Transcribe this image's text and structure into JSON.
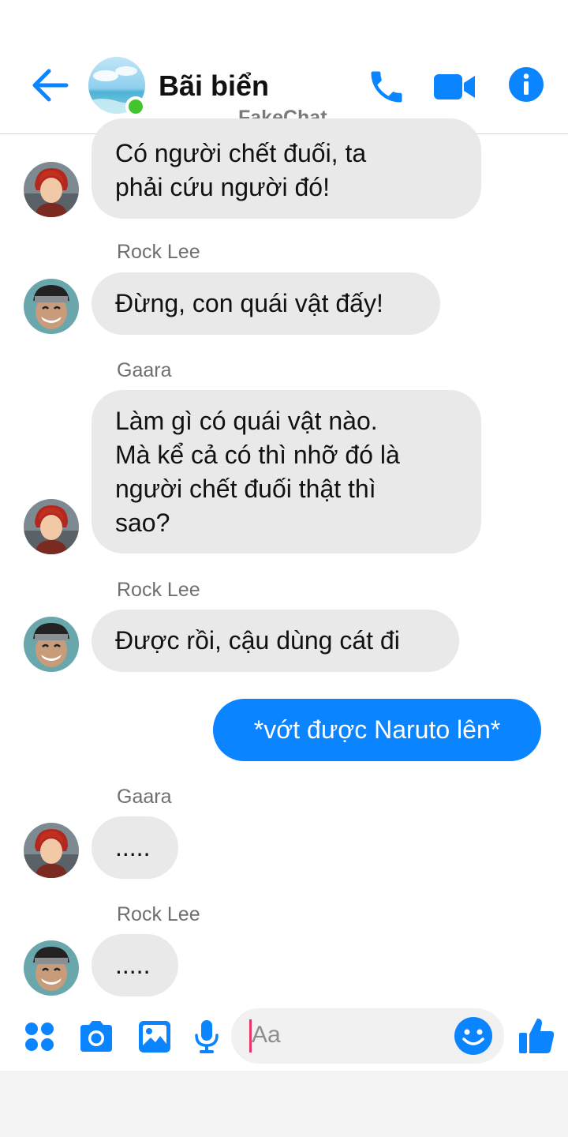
{
  "header": {
    "title": "Bãi biển",
    "watermark": "FakeChat",
    "icons": [
      "back-arrow-icon",
      "phone-icon",
      "video-camera-icon",
      "info-icon"
    ],
    "accent_color": "#0a84ff",
    "online_color": "#42c52d"
  },
  "messages": [
    {
      "sender": "",
      "direction": "in",
      "lines": [
        "Có người chết đuối, ta",
        "phải cứu người đó!"
      ]
    },
    {
      "sender": "Rock Lee",
      "direction": "in",
      "lines": [
        "Đừng, con quái vật đấy!"
      ]
    },
    {
      "sender": "Gaara",
      "direction": "in",
      "lines": [
        "Làm gì có quái vật nào.",
        "Mà kể cả có thì nhỡ đó là",
        "người chết đuối thật thì",
        "sao?"
      ]
    },
    {
      "sender": "Rock Lee",
      "direction": "in",
      "lines": [
        "Được rồi, cậu dùng cát đi"
      ]
    },
    {
      "sender": "",
      "direction": "out",
      "lines": [
        "*vớt được Naruto lên*"
      ]
    },
    {
      "sender": "Gaara",
      "direction": "in",
      "lines": [
        "....."
      ]
    },
    {
      "sender": "Rock Lee",
      "direction": "in",
      "lines": [
        "....."
      ]
    }
  ],
  "composer": {
    "placeholder": "Aa",
    "icons": [
      "apps-grid-icon",
      "camera-icon",
      "gallery-icon",
      "microphone-icon",
      "emoji-icon",
      "thumbs-up-icon"
    ]
  }
}
